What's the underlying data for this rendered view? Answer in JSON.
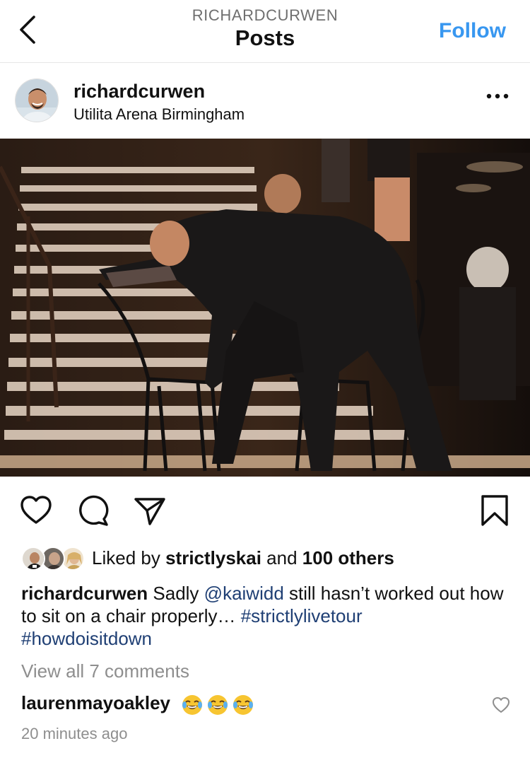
{
  "header": {
    "username_upper": "RICHARDCURWEN",
    "title": "Posts",
    "follow_label": "Follow",
    "back_icon": "chevron-left-icon"
  },
  "post": {
    "username": "richardcurwen",
    "location": "Utilita Arena Birmingham",
    "more_icon": "more-horizontal-icon",
    "photo_description_icon": "post-photo"
  },
  "actions": {
    "like_icon": "heart-icon",
    "comment_icon": "comment-icon",
    "share_icon": "send-icon",
    "save_icon": "bookmark-icon"
  },
  "likes": {
    "prefix": "Liked by ",
    "first_liker": "strictlyskai",
    "middle": " and ",
    "others": "100 others"
  },
  "caption": {
    "username": "richardcurwen",
    "text_1": " Sadly ",
    "mention": "@kaiwidd",
    "text_2": " still hasn’t worked out how to sit on a chair properly… ",
    "hashtag_1": "#strictlylivetour",
    "hashtag_2": "#howdoisitdown"
  },
  "view_all_comments": "View all 7 comments",
  "comment": {
    "username": "laurenmayoakley",
    "emoji_icon": "face-with-tears-of-joy-icon",
    "like_icon": "heart-outline-icon"
  },
  "timestamp": "20 minutes ago",
  "colors": {
    "link_blue": "#3897f0",
    "hashtag_blue": "#1f3f74",
    "muted_gray": "#8e8e8e"
  }
}
